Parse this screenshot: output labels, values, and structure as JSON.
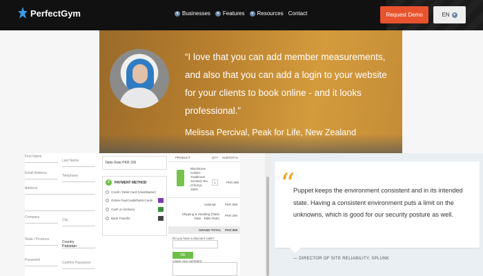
{
  "nav": {
    "brand": "PerfectGym",
    "links": [
      "Businesses",
      "Features",
      "Resources",
      "Contact"
    ],
    "cta": "Request Demo",
    "lang": "EN"
  },
  "testimonial": {
    "quote": "“I love that you can add member measurements, and also that you can add a login to your website for your clients to book online - and it looks professional.”",
    "author": "Melissa Percival, Peak for Life, New Zealand"
  },
  "checkout": {
    "fields_left": [
      "First Name",
      "Email Address",
      "Address",
      "",
      "Company",
      "State / Province",
      "Password"
    ],
    "fields_right": [
      "Last Name",
      "Telephone",
      "",
      "",
      "City",
      "Country",
      "Confirm Password"
    ],
    "country_value": "Pakistan",
    "table_rate": "Table Rate  PKR 200",
    "payment": {
      "number": "2",
      "title": "PAYMENT METHOD",
      "options": [
        "Credit / Debit Card (Visa/Master)",
        "Online Pay/Credit/Debit Cards",
        "Cash on Delivery",
        "Bank Transfer"
      ]
    },
    "order": {
      "headers": [
        "PRODUCT",
        "QTY",
        "SUBTOTAL"
      ],
      "product_name": "Blackstone Golden Traditional Scented Tea (Cherry) 250G",
      "qty": "1",
      "price": "PKR 699",
      "subtotal_label": "Subtotal",
      "subtotal_value": "PKR 699",
      "shipping_label": "Shipping & Handling (Table Rate - Table Rate)",
      "shipping_value": "PKR 200",
      "grand_label": "GRAND TOTAL",
      "grand_value": "PKR 899",
      "coupon_label": "Do you have a discount code?",
      "coupon_btn": "OK",
      "comment_label": "Leave your comment"
    }
  },
  "right_quote": {
    "mark": "“",
    "text": "Puppet keeps the environment consistent and in its intended state. Having a consistent environment puts a limit on the unknowns, which is good for our security posture as well.",
    "author": "— DIRECTOR OF SITE RELIABILITY, SPLUNK"
  }
}
